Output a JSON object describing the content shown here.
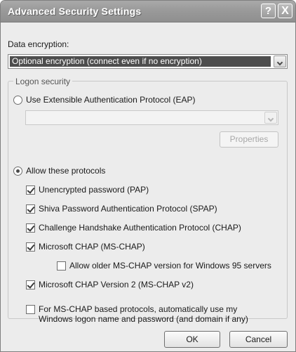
{
  "window": {
    "title": "Advanced Security Settings",
    "help_glyph": "?",
    "close_glyph": "X"
  },
  "encryption": {
    "label": "Data encryption:",
    "selected": "Optional encryption (connect even if no encryption)"
  },
  "logon": {
    "group_title": "Logon security",
    "eap_radio": {
      "label": "Use Extensible Authentication Protocol (EAP)",
      "selected": false
    },
    "eap_combo": {
      "value": "",
      "enabled": false
    },
    "properties_button": {
      "label": "Properties",
      "enabled": false
    },
    "allow_radio": {
      "label": "Allow these protocols",
      "selected": true
    },
    "protocols": [
      {
        "label": "Unencrypted password (PAP)",
        "checked": true
      },
      {
        "label": "Shiva Password Authentication Protocol (SPAP)",
        "checked": true
      },
      {
        "label": "Challenge Handshake Authentication Protocol (CHAP)",
        "checked": true
      },
      {
        "label": "Microsoft CHAP (MS-CHAP)",
        "checked": true
      },
      {
        "label": "Allow older MS-CHAP version for Windows 95 servers",
        "checked": false
      },
      {
        "label": "Microsoft CHAP Version 2 (MS-CHAP v2)",
        "checked": true
      }
    ],
    "auto_logon": {
      "line1": "For MS-CHAP based protocols, automatically use my",
      "line2": "Windows logon name and password (and domain if any)",
      "checked": false
    }
  },
  "buttons": {
    "ok": "OK",
    "cancel": "Cancel"
  }
}
